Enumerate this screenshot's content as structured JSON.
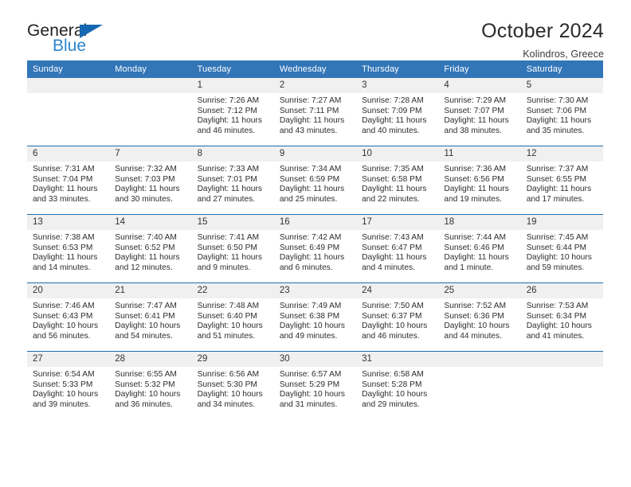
{
  "brand": {
    "name_top": "General",
    "name_bottom": "Blue",
    "accent_color": "#2b84d0",
    "triangle_color": "#1667b1"
  },
  "header": {
    "title": "October 2024",
    "subtitle": "Kolindros, Greece"
  },
  "theme": {
    "header_bg": "#3276b8",
    "week_separator": "#1f6cb0",
    "daynum_bg": "#f0f0f0"
  },
  "weekday_headers": [
    "Sunday",
    "Monday",
    "Tuesday",
    "Wednesday",
    "Thursday",
    "Friday",
    "Saturday"
  ],
  "weeks": [
    [
      {
        "day": "",
        "empty": true
      },
      {
        "day": "",
        "empty": true
      },
      {
        "day": "1",
        "sunrise": "Sunrise: 7:26 AM",
        "sunset": "Sunset: 7:12 PM",
        "daylight": "Daylight: 11 hours and 46 minutes."
      },
      {
        "day": "2",
        "sunrise": "Sunrise: 7:27 AM",
        "sunset": "Sunset: 7:11 PM",
        "daylight": "Daylight: 11 hours and 43 minutes."
      },
      {
        "day": "3",
        "sunrise": "Sunrise: 7:28 AM",
        "sunset": "Sunset: 7:09 PM",
        "daylight": "Daylight: 11 hours and 40 minutes."
      },
      {
        "day": "4",
        "sunrise": "Sunrise: 7:29 AM",
        "sunset": "Sunset: 7:07 PM",
        "daylight": "Daylight: 11 hours and 38 minutes."
      },
      {
        "day": "5",
        "sunrise": "Sunrise: 7:30 AM",
        "sunset": "Sunset: 7:06 PM",
        "daylight": "Daylight: 11 hours and 35 minutes."
      }
    ],
    [
      {
        "day": "6",
        "sunrise": "Sunrise: 7:31 AM",
        "sunset": "Sunset: 7:04 PM",
        "daylight": "Daylight: 11 hours and 33 minutes."
      },
      {
        "day": "7",
        "sunrise": "Sunrise: 7:32 AM",
        "sunset": "Sunset: 7:03 PM",
        "daylight": "Daylight: 11 hours and 30 minutes."
      },
      {
        "day": "8",
        "sunrise": "Sunrise: 7:33 AM",
        "sunset": "Sunset: 7:01 PM",
        "daylight": "Daylight: 11 hours and 27 minutes."
      },
      {
        "day": "9",
        "sunrise": "Sunrise: 7:34 AM",
        "sunset": "Sunset: 6:59 PM",
        "daylight": "Daylight: 11 hours and 25 minutes."
      },
      {
        "day": "10",
        "sunrise": "Sunrise: 7:35 AM",
        "sunset": "Sunset: 6:58 PM",
        "daylight": "Daylight: 11 hours and 22 minutes."
      },
      {
        "day": "11",
        "sunrise": "Sunrise: 7:36 AM",
        "sunset": "Sunset: 6:56 PM",
        "daylight": "Daylight: 11 hours and 19 minutes."
      },
      {
        "day": "12",
        "sunrise": "Sunrise: 7:37 AM",
        "sunset": "Sunset: 6:55 PM",
        "daylight": "Daylight: 11 hours and 17 minutes."
      }
    ],
    [
      {
        "day": "13",
        "sunrise": "Sunrise: 7:38 AM",
        "sunset": "Sunset: 6:53 PM",
        "daylight": "Daylight: 11 hours and 14 minutes."
      },
      {
        "day": "14",
        "sunrise": "Sunrise: 7:40 AM",
        "sunset": "Sunset: 6:52 PM",
        "daylight": "Daylight: 11 hours and 12 minutes."
      },
      {
        "day": "15",
        "sunrise": "Sunrise: 7:41 AM",
        "sunset": "Sunset: 6:50 PM",
        "daylight": "Daylight: 11 hours and 9 minutes."
      },
      {
        "day": "16",
        "sunrise": "Sunrise: 7:42 AM",
        "sunset": "Sunset: 6:49 PM",
        "daylight": "Daylight: 11 hours and 6 minutes."
      },
      {
        "day": "17",
        "sunrise": "Sunrise: 7:43 AM",
        "sunset": "Sunset: 6:47 PM",
        "daylight": "Daylight: 11 hours and 4 minutes."
      },
      {
        "day": "18",
        "sunrise": "Sunrise: 7:44 AM",
        "sunset": "Sunset: 6:46 PM",
        "daylight": "Daylight: 11 hours and 1 minute."
      },
      {
        "day": "19",
        "sunrise": "Sunrise: 7:45 AM",
        "sunset": "Sunset: 6:44 PM",
        "daylight": "Daylight: 10 hours and 59 minutes."
      }
    ],
    [
      {
        "day": "20",
        "sunrise": "Sunrise: 7:46 AM",
        "sunset": "Sunset: 6:43 PM",
        "daylight": "Daylight: 10 hours and 56 minutes."
      },
      {
        "day": "21",
        "sunrise": "Sunrise: 7:47 AM",
        "sunset": "Sunset: 6:41 PM",
        "daylight": "Daylight: 10 hours and 54 minutes."
      },
      {
        "day": "22",
        "sunrise": "Sunrise: 7:48 AM",
        "sunset": "Sunset: 6:40 PM",
        "daylight": "Daylight: 10 hours and 51 minutes."
      },
      {
        "day": "23",
        "sunrise": "Sunrise: 7:49 AM",
        "sunset": "Sunset: 6:38 PM",
        "daylight": "Daylight: 10 hours and 49 minutes."
      },
      {
        "day": "24",
        "sunrise": "Sunrise: 7:50 AM",
        "sunset": "Sunset: 6:37 PM",
        "daylight": "Daylight: 10 hours and 46 minutes."
      },
      {
        "day": "25",
        "sunrise": "Sunrise: 7:52 AM",
        "sunset": "Sunset: 6:36 PM",
        "daylight": "Daylight: 10 hours and 44 minutes."
      },
      {
        "day": "26",
        "sunrise": "Sunrise: 7:53 AM",
        "sunset": "Sunset: 6:34 PM",
        "daylight": "Daylight: 10 hours and 41 minutes."
      }
    ],
    [
      {
        "day": "27",
        "sunrise": "Sunrise: 6:54 AM",
        "sunset": "Sunset: 5:33 PM",
        "daylight": "Daylight: 10 hours and 39 minutes."
      },
      {
        "day": "28",
        "sunrise": "Sunrise: 6:55 AM",
        "sunset": "Sunset: 5:32 PM",
        "daylight": "Daylight: 10 hours and 36 minutes."
      },
      {
        "day": "29",
        "sunrise": "Sunrise: 6:56 AM",
        "sunset": "Sunset: 5:30 PM",
        "daylight": "Daylight: 10 hours and 34 minutes."
      },
      {
        "day": "30",
        "sunrise": "Sunrise: 6:57 AM",
        "sunset": "Sunset: 5:29 PM",
        "daylight": "Daylight: 10 hours and 31 minutes."
      },
      {
        "day": "31",
        "sunrise": "Sunrise: 6:58 AM",
        "sunset": "Sunset: 5:28 PM",
        "daylight": "Daylight: 10 hours and 29 minutes."
      },
      {
        "day": "",
        "empty": true
      },
      {
        "day": "",
        "empty": true
      }
    ]
  ]
}
